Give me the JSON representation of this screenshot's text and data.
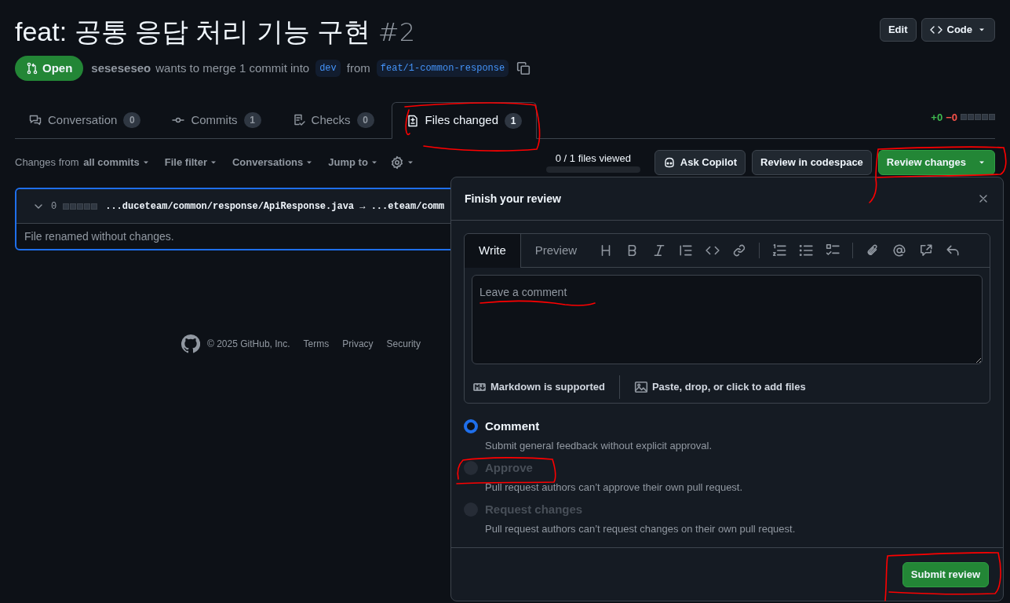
{
  "pull_request": {
    "title": "feat: 공통 응답 처리 기능 구현",
    "number": "#2",
    "state": "Open",
    "author": "seseseseo",
    "merge_text": "wants to merge 1 commit into",
    "base_branch": "dev",
    "from_text": "from",
    "head_branch": "feat/1-common-response"
  },
  "header_buttons": [
    {
      "kind": "plain",
      "label": "Edit"
    },
    {
      "kind": "code",
      "label": "Code"
    }
  ],
  "tabs": [
    {
      "kind": "conversation",
      "label": "Conversation",
      "count": "0",
      "selected": false
    },
    {
      "kind": "commits",
      "label": "Commits",
      "count": "1",
      "selected": false
    },
    {
      "kind": "checks",
      "label": "Checks",
      "count": "0",
      "selected": false
    },
    {
      "kind": "files",
      "label": "Files changed",
      "count": "1",
      "selected": true
    }
  ],
  "diffstat": {
    "additions": "+0",
    "deletions": "−0"
  },
  "toolbar": {
    "filters": [
      {
        "prefix": "Changes from",
        "label": "all commits"
      },
      {
        "label": "File filter"
      },
      {
        "label": "Conversations"
      },
      {
        "label": "Jump to"
      }
    ],
    "files_viewed": {
      "text": "0 / 1 files viewed",
      "level": 0
    },
    "buttons": [
      {
        "kind": "copilot",
        "label": "Ask Copilot"
      },
      {
        "kind": "plain",
        "label": "Review in codespace"
      },
      {
        "kind": "primary",
        "label": "Review changes"
      }
    ]
  },
  "file": {
    "changes": "0",
    "path": "...duceteam/common/response/ApiResponse.java → ...eteam/comm",
    "message": "File renamed without changes.",
    "expanded": true
  },
  "footer": {
    "copyright": "© 2025 GitHub, Inc.",
    "links": [
      "Terms",
      "Privacy",
      "Security"
    ]
  },
  "review_dialog": {
    "title": "Finish your review",
    "editor_tabs": [
      {
        "label": "Write",
        "selected": true
      },
      {
        "label": "Preview",
        "selected": false
      }
    ],
    "placeholder": "Leave a comment",
    "markdown_note": "Markdown is supported",
    "attach_note": "Paste, drop, or click to add files",
    "options": [
      {
        "label": "Comment",
        "description": "Submit general feedback without explicit approval.",
        "selected": true,
        "disabled": false
      },
      {
        "label": "Approve",
        "description": "Pull request authors can’t approve their own pull request.",
        "selected": false,
        "disabled": true
      },
      {
        "label": "Request changes",
        "description": "Pull request authors can’t request changes on their own pull request.",
        "selected": false,
        "disabled": true
      }
    ],
    "submit": "Submit review"
  }
}
